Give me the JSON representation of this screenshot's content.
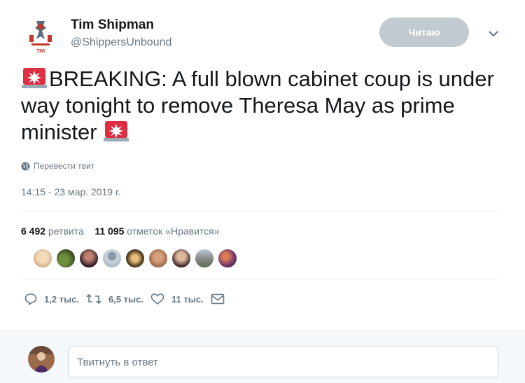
{
  "author": {
    "name": "Tim Shipman",
    "handle": "@ShippersUnbound",
    "avatar_text": "TIM"
  },
  "follow_button": {
    "label": "Читаю"
  },
  "tweet": {
    "text_part1": "BREAKING: A full blown cabinet coup is under way tonight to remove Theresa May as prime minister",
    "emoji": "rotating-light-emoji",
    "translate_label": "Перевести твит",
    "timestamp": "14:15 - 23 мар. 2019 г."
  },
  "stats": {
    "retweets_count": "6 492",
    "retweets_label": "ретвита",
    "likes_count": "11 095",
    "likes_label": "отметок «Нравится»"
  },
  "likers_count_shown": 9,
  "actions": {
    "replies": "1,2 тыс.",
    "retweets": "6,5 тыс.",
    "likes": "11 тыс."
  },
  "reply": {
    "placeholder": "Твитнуть в ответ"
  },
  "colors": {
    "text": "#14171a",
    "secondary": "#657786",
    "follow_bg": "#c2cad1",
    "siren_red": "#e0245e",
    "divider": "#e6ecf0"
  }
}
